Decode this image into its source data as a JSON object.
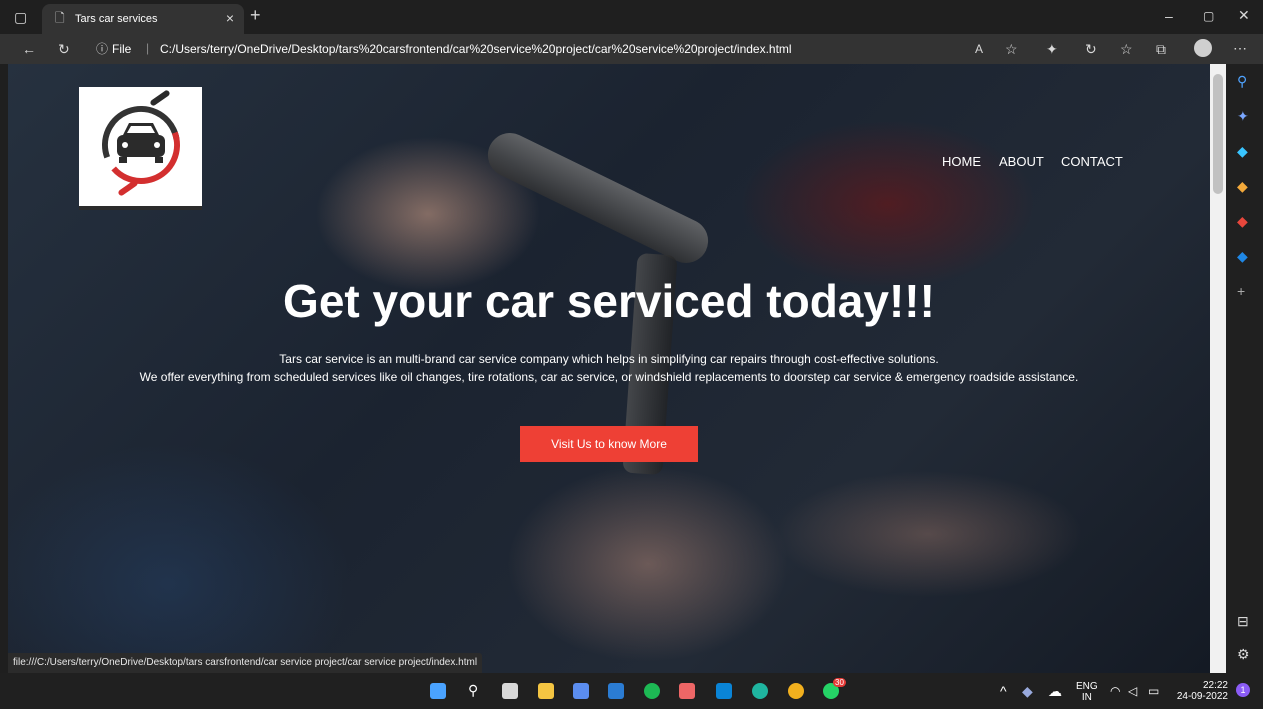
{
  "browser": {
    "tab_title": "Tars car services",
    "new_tab": "+",
    "url_prefix": "File",
    "url": "C:/Users/terry/OneDrive/Desktop/tars%20carsfrontend/car%20service%20project/car%20service%20project/index.html",
    "status_url": "file:///C:/Users/terry/OneDrive/Desktop/tars carsfrontend/car service project/car service project/index.html"
  },
  "page": {
    "nav": [
      "HOME",
      "ABOUT",
      "CONTACT"
    ],
    "hero_title": "Get your car serviced today!!!",
    "desc_line1": "Tars car service is an multi-brand car service company which helps in simplifying car repairs through cost-effective solutions.",
    "desc_line2": "We offer everything from scheduled services like oil changes, tire rotations, car ac service, or windshield replacements to doorstep car service & emergency roadside assistance.",
    "cta_label": "Visit Us to know More"
  },
  "taskbar": {
    "badge": "30",
    "lang1": "ENG",
    "lang2": "IN",
    "time": "22:22",
    "date": "24-09-2022",
    "notif": "1"
  },
  "colors": {
    "accent": "#ee4035",
    "sidebar": "#202020",
    "chrome": "#333333"
  }
}
